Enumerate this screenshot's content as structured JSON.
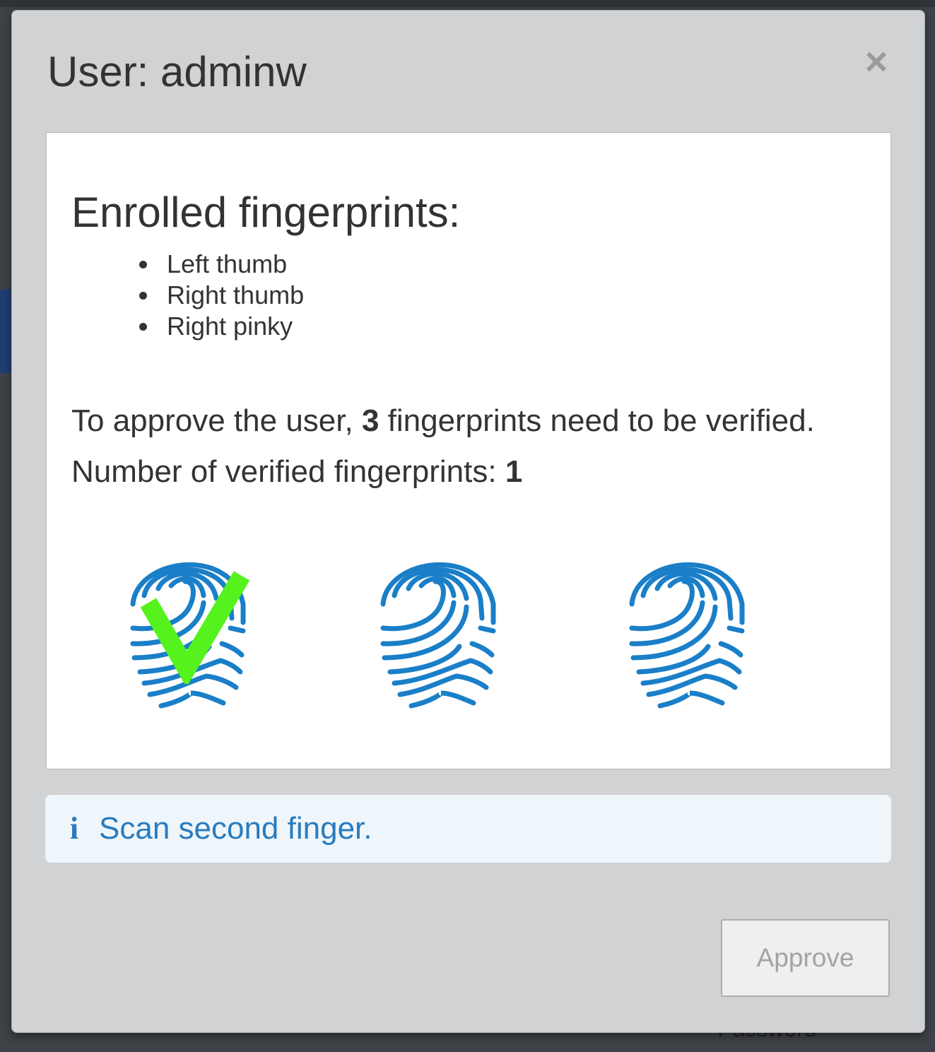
{
  "dialog": {
    "title": "User: adminw",
    "close_glyph": "×"
  },
  "panel": {
    "heading": "Enrolled fingerprints:",
    "enrolled_fingers": [
      "Left thumb",
      "Right thumb",
      "Right pinky"
    ],
    "requirement_prefix": "To approve the user, ",
    "required_count": "3",
    "requirement_suffix": " fingerprints need to be verified.",
    "verified_prefix": "Number of verified fingerprints: ",
    "verified_count": "1",
    "fingerprints": [
      {
        "icon": "fingerprint-icon",
        "verified": true
      },
      {
        "icon": "fingerprint-icon",
        "verified": false
      },
      {
        "icon": "fingerprint-icon",
        "verified": false
      }
    ]
  },
  "alert": {
    "icon": "info-icon",
    "icon_glyph": "i",
    "message": "Scan second finger."
  },
  "footer": {
    "approve_label": "Approve",
    "approve_enabled": false
  },
  "background": {
    "partial_text": "Password"
  },
  "colors": {
    "fingerprint": "#1a7fc8",
    "checkmark": "#55f21d",
    "alert_text": "#2a7bbd",
    "alert_bg": "#eef6fb",
    "modal_bg": "#d1d2d4"
  }
}
